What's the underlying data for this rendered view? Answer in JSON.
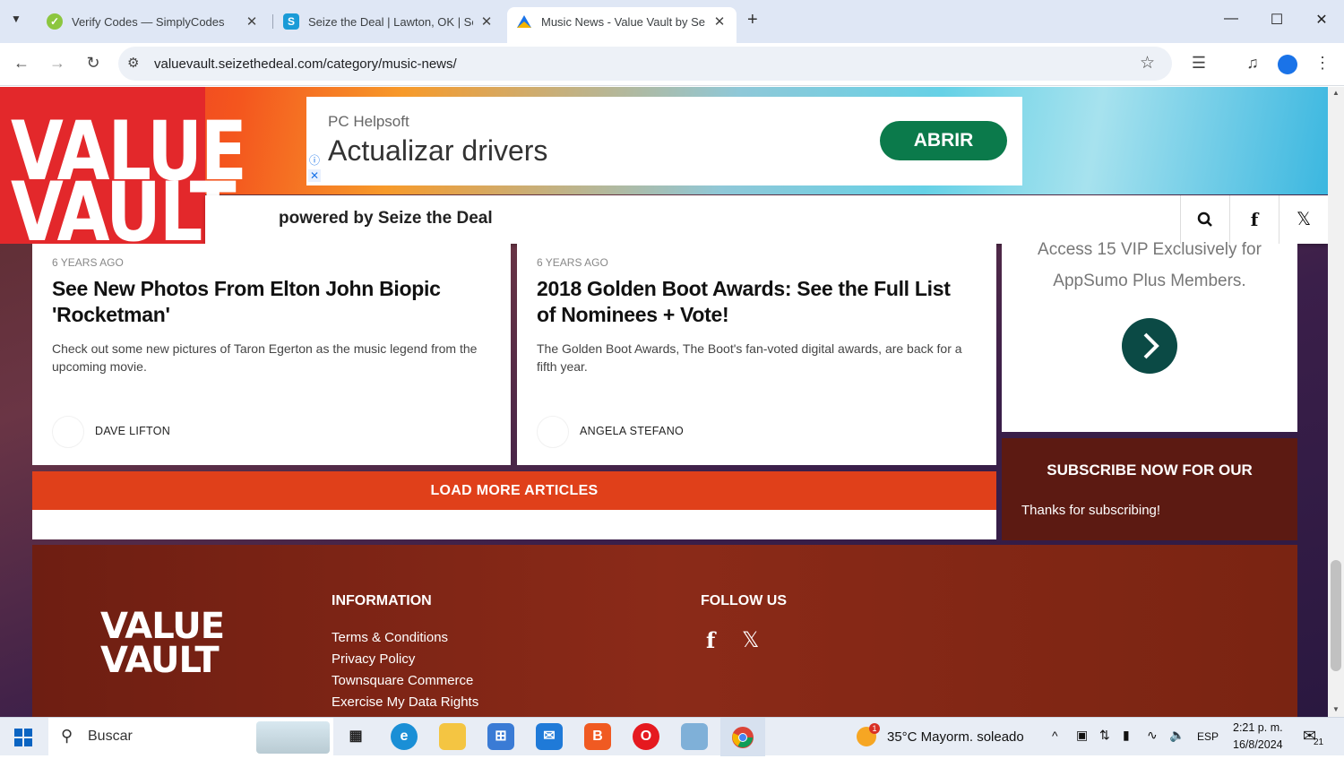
{
  "browser": {
    "tabs": [
      {
        "title": "Verify Codes — SimplyCodes",
        "active": false
      },
      {
        "title": "Seize the Deal | Lawton, OK | Se",
        "active": false
      },
      {
        "title": "Music News - Value Vault by Se",
        "active": true
      }
    ],
    "url": "valuevault.seizethedeal.com/category/music-news/"
  },
  "site": {
    "logo_line1": "VALUE",
    "logo_line2": "VAULT",
    "powered_by": "powered by Seize the Deal"
  },
  "ad": {
    "brand": "PC Helpsoft",
    "headline": "Actualizar drivers",
    "cta": "ABRIR"
  },
  "articles": [
    {
      "age": "6 YEARS AGO",
      "title": "See New Photos From Elton John Biopic 'Rocketman'",
      "excerpt": "Check out some new pictures of Taron Egerton as the music legend from the upcoming movie.",
      "author": "DAVE LIFTON"
    },
    {
      "age": "6 YEARS AGO",
      "title": "2018 Golden Boot Awards: See the Full List of Nominees + Vote!",
      "excerpt": "The Golden Boot Awards, The Boot's fan-voted digital awards, are back for a fifth year.",
      "author": "ANGELA STEFANO"
    }
  ],
  "promo": {
    "line1": "Access 15 VIP Exclusively for",
    "line2": "AppSumo Plus Members."
  },
  "load_more": "LOAD MORE ARTICLES",
  "subscribe": {
    "heading": "SUBSCRIBE NOW FOR OUR",
    "message": "Thanks for subscribing!"
  },
  "footer": {
    "logo_line1": "VALUE",
    "logo_line2": "VAULT",
    "information_heading": "INFORMATION",
    "links": [
      "Terms & Conditions",
      "Privacy Policy",
      "Townsquare Commerce",
      "Exercise My Data Rights"
    ],
    "follow_heading": "FOLLOW US"
  },
  "taskbar": {
    "search_placeholder": "Buscar",
    "weather": "35°C  Mayorm. soleado",
    "weather_badge": "1",
    "language": "ESP",
    "time": "2:21 p. m.",
    "date": "16/8/2024",
    "notifications": "21"
  },
  "colors": {
    "brand_red": "#e3282b",
    "load_more": "#e0401a",
    "cta_green": "#0b7a4b",
    "footer": "#8b2a18"
  }
}
